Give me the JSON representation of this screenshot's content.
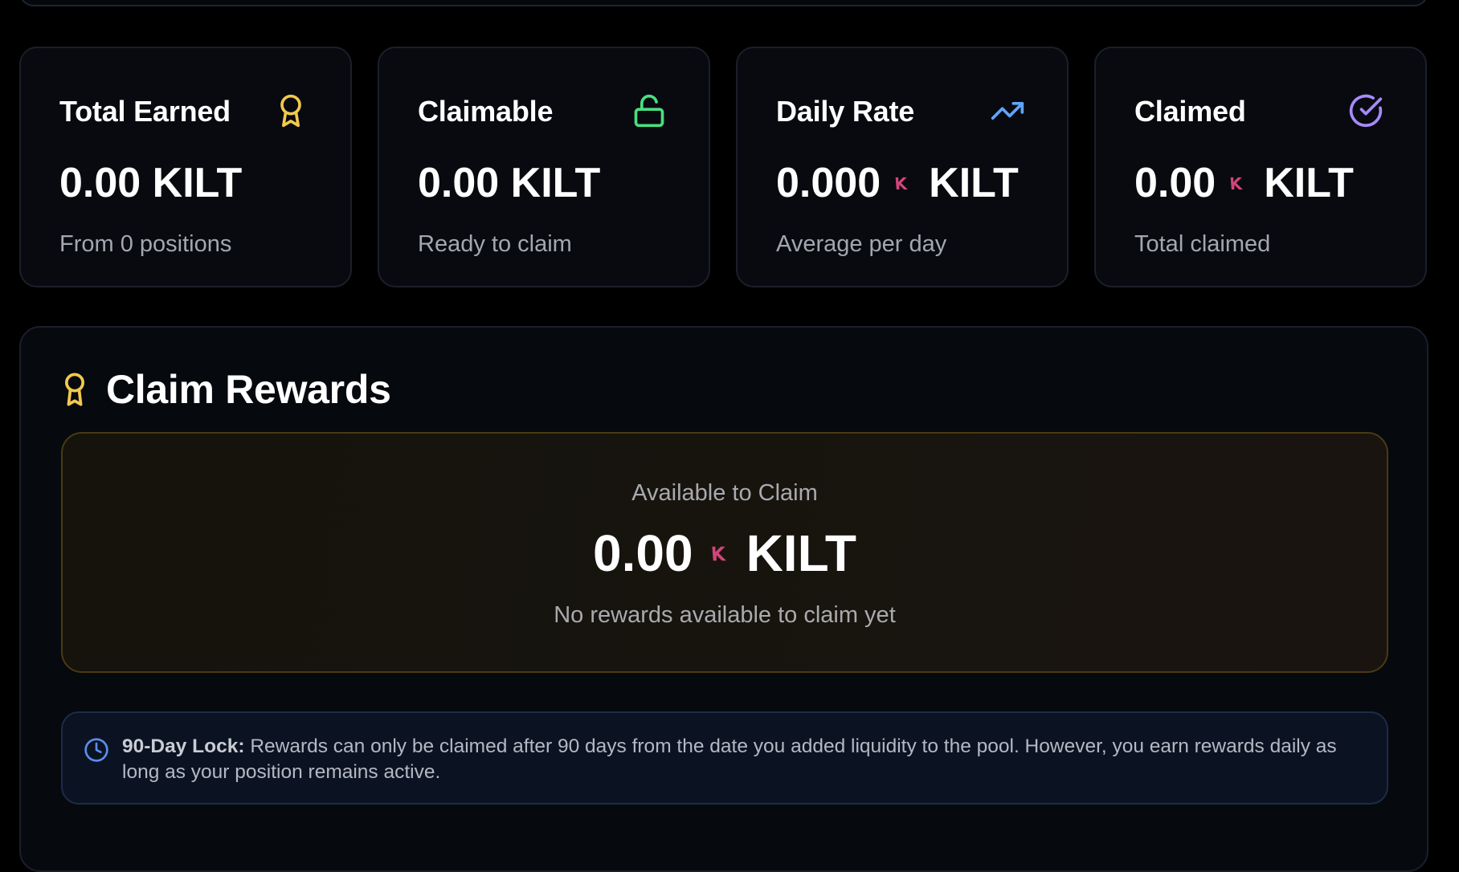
{
  "stats": {
    "total_earned": {
      "title": "Total Earned",
      "amount": "0.00 KILT",
      "sub": "From 0 positions",
      "icon": "award-icon",
      "icon_color": "#f2c94c"
    },
    "claimable": {
      "title": "Claimable",
      "amount": "0.00 KILT",
      "sub": "Ready to claim",
      "icon": "unlock-icon",
      "icon_color": "#4ade80"
    },
    "daily_rate": {
      "title": "Daily Rate",
      "amount": "0.000",
      "unit": "KILT",
      "sub": "Average per day",
      "icon": "trending-up-icon",
      "icon_color": "#60a5fa"
    },
    "claimed": {
      "title": "Claimed",
      "amount": "0.00",
      "unit": "KILT",
      "sub": "Total claimed",
      "icon": "check-circle-icon",
      "icon_color": "#a78bfa"
    }
  },
  "claim": {
    "heading": "Claim Rewards",
    "available_label": "Available to Claim",
    "amount": "0.00",
    "unit": "KILT",
    "note": "No rewards available to claim yet"
  },
  "lock_notice": {
    "title": "90-Day Lock:",
    "body": " Rewards can only be claimed after 90 days from the date you added liquidity to the pool. However, you earn rewards daily as long as your position remains active.",
    "icon": "clock-icon"
  },
  "colors": {
    "kilt_logo": "#d1457a",
    "award": "#f2c94c",
    "clock": "#5b8def"
  }
}
